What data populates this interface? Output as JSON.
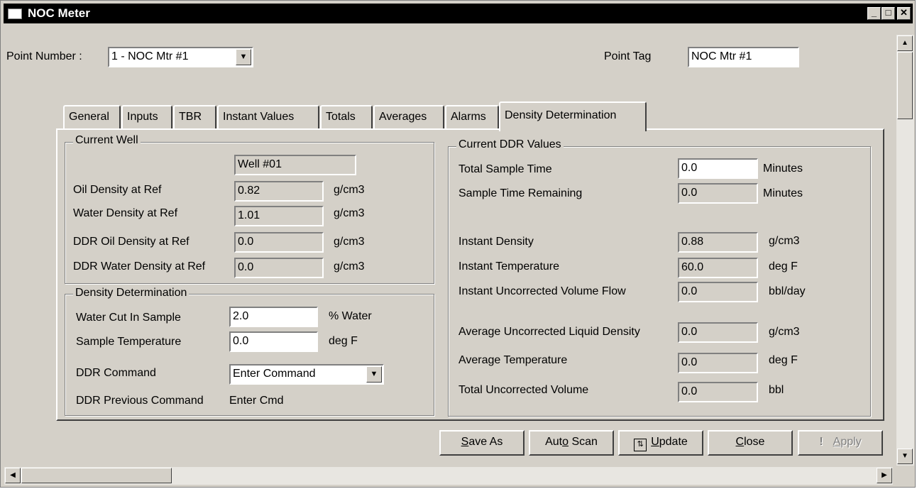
{
  "window": {
    "title": "NOC Meter"
  },
  "header": {
    "point_number_label": "Point Number :",
    "point_number_value": "1 - NOC Mtr #1",
    "point_tag_label": "Point Tag",
    "point_tag_value": "NOC Mtr #1"
  },
  "tabs": [
    "General",
    "Inputs",
    "TBR",
    "Instant Values",
    "Totals",
    "Averages",
    "Alarms",
    "Density Determination"
  ],
  "active_tab": "Density Determination",
  "current_well": {
    "legend": "Current Well",
    "well_name": "Well #01",
    "rows": [
      {
        "label": "Oil  Density at Ref",
        "value": "0.82",
        "unit": "g/cm3"
      },
      {
        "label": "Water Density at Ref",
        "value": "1.01",
        "unit": "g/cm3"
      },
      {
        "label": "DDR Oil Density at Ref",
        "value": "0.0",
        "unit": "g/cm3"
      },
      {
        "label": "DDR Water Density at Ref",
        "value": "0.0",
        "unit": "g/cm3"
      }
    ]
  },
  "density_determination": {
    "legend": "Density Determination",
    "water_cut_label": "Water Cut In Sample",
    "water_cut_value": "2.0",
    "water_cut_unit": "% Water",
    "sample_temp_label": "Sample Temperature",
    "sample_temp_value": "0.0",
    "sample_temp_unit": "deg F",
    "ddr_command_label": "DDR Command",
    "ddr_command_value": "Enter Command",
    "ddr_prev_label": "DDR Previous Command",
    "ddr_prev_value": "Enter Cmd"
  },
  "current_ddr": {
    "legend": "Current DDR Values",
    "rows": [
      {
        "label": "Total Sample Time",
        "value": "0.0",
        "unit": "Minutes"
      },
      {
        "label": "Sample Time Remaining",
        "value": "0.0",
        "unit": "Minutes"
      },
      {
        "label": "Instant Density",
        "value": "0.88",
        "unit": "g/cm3"
      },
      {
        "label": "Instant Temperature",
        "value": "60.0",
        "unit": "deg F"
      },
      {
        "label": "Instant Uncorrected Volume Flow",
        "value": "0.0",
        "unit": "bbl/day"
      },
      {
        "label": "Average Uncorrected Liquid Density",
        "value": "0.0",
        "unit": "g/cm3"
      },
      {
        "label": "Average Temperature",
        "value": "0.0",
        "unit": "deg F"
      },
      {
        "label": "Total Uncorrected Volume",
        "value": "0.0",
        "unit": "bbl"
      }
    ]
  },
  "buttons": {
    "save_as_u": "S",
    "save_as_rest": "ave As",
    "auto_scan_a": "Aut",
    "auto_scan_u": "o",
    "auto_scan_b": " Scan",
    "update_u": "U",
    "update_rest": "pdate",
    "close_u": "C",
    "close_rest": "lose",
    "apply_u": "A",
    "apply_rest": "pply"
  }
}
